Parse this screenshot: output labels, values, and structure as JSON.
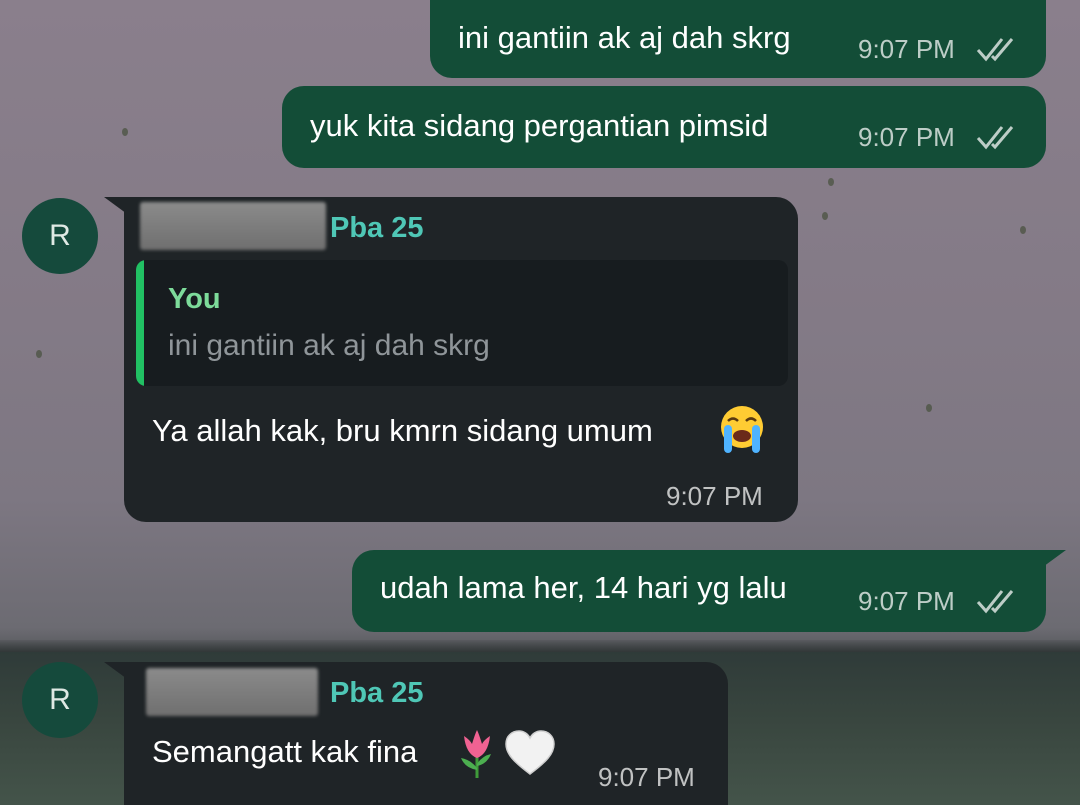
{
  "messages": [
    {
      "direction": "outgoing",
      "text": "ini gantiin ak aj dah skrg",
      "time": "9:07 PM",
      "status_icon": "double-check-icon"
    },
    {
      "direction": "outgoing",
      "text": "yuk kita sidang pergantian pimsid",
      "time": "9:07 PM",
      "status_icon": "double-check-icon"
    },
    {
      "direction": "incoming",
      "avatar_letter": "R",
      "sender_suffix": "Pba 25",
      "reply": {
        "author": "You",
        "text": "ini gantiin ak aj dah skrg"
      },
      "text": "Ya allah kak, bru kmrn sidang umum",
      "emojis": [
        "loudly-crying-face-emoji"
      ],
      "time": "9:07 PM"
    },
    {
      "direction": "outgoing",
      "text": "udah lama her, 14 hari yg lalu",
      "time": "9:07 PM",
      "status_icon": "double-check-icon"
    },
    {
      "direction": "incoming",
      "avatar_letter": "R",
      "sender_suffix": "Pba 25",
      "text": "Semangatt kak fina",
      "emojis": [
        "tulip-emoji",
        "white-heart-emoji"
      ],
      "time": "9:07 PM"
    }
  ],
  "colors": {
    "outgoing_bubble": "#134d37",
    "incoming_bubble": "#1f2427",
    "sender_name": "#4fc7b6",
    "quote_bar": "#21c063",
    "quote_author": "#7ddb9a",
    "avatar_bg": "#154a3c"
  }
}
